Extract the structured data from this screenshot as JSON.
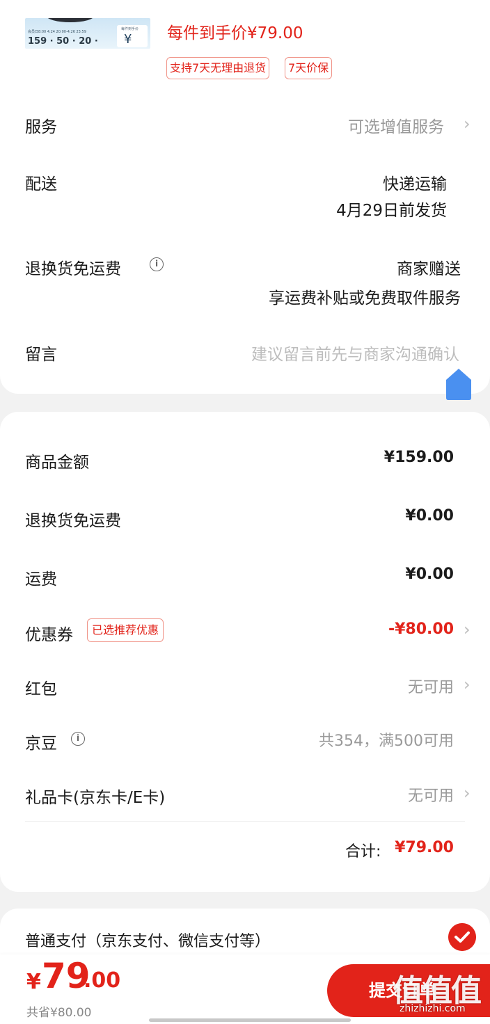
{
  "product": {
    "thumb_top_line": "会员日8:00 4.24 20:00-4.26 23:59",
    "thumb_numbers": "159 · 50 · 20 · ",
    "thumb_chip_label": "每件到手价",
    "thumb_chip_value": "¥ 89",
    "unit_price": "每件到手价¥79.00",
    "tags": [
      "支持7天无理由退货",
      "7天价保"
    ]
  },
  "order_info": {
    "service": {
      "label": "服务",
      "value": "可选增值服务"
    },
    "delivery": {
      "label": "配送",
      "line1": "快递运输",
      "line2": "4月29日前发货"
    },
    "return_free": {
      "label": "退换货免运费",
      "line1": "商家赠送",
      "line2": "享运费补贴或免费取件服务"
    },
    "message": {
      "label": "留言",
      "placeholder": "建议留言前先与商家沟通确认"
    }
  },
  "summary": {
    "goods_amount": {
      "label": "商品金额",
      "value": "¥159.00"
    },
    "return_fee": {
      "label": "退换货免运费",
      "value": "¥0.00"
    },
    "shipping": {
      "label": "运费",
      "value": "¥0.00"
    },
    "coupon": {
      "label": "优惠券",
      "tag": "已选推荐优惠",
      "value": "-¥80.00"
    },
    "red_packet": {
      "label": "红包",
      "value": "无可用"
    },
    "jingdou": {
      "label": "京豆",
      "value": "共354，满500可用"
    },
    "gift_card": {
      "label": "礼品卡(京东卡/E卡)",
      "value": "无可用"
    },
    "total_label": "合计:",
    "total_value": "¥79.00"
  },
  "payment": {
    "method": "普通支付（京东支付、微信支付等）"
  },
  "bottom": {
    "currency": "¥",
    "price_int": "79",
    "price_dec": ".00",
    "saved": "共省¥80.00",
    "submit": "提交订单",
    "watermark": "值值值",
    "watermark_url": "zhizhizhi.com"
  },
  "colors": {
    "accent": "#e2231a",
    "home_icon": "#4a90f0"
  }
}
